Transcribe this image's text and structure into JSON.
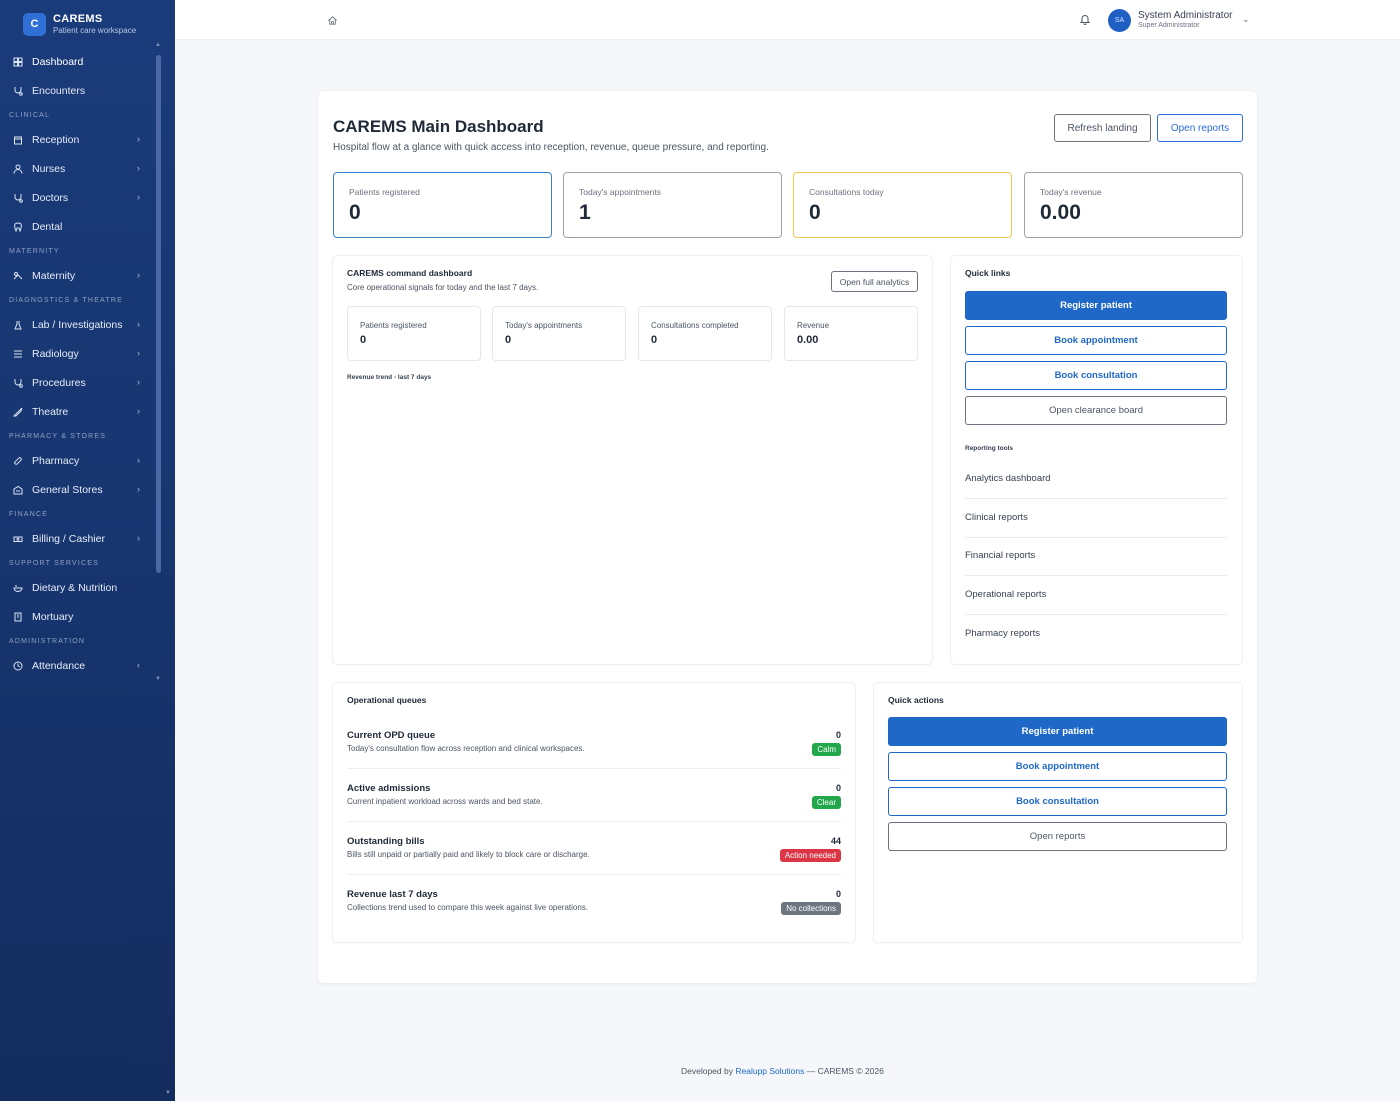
{
  "brand": {
    "logo": "C",
    "title": "CAREMS",
    "subtitle": "Patient care workspace"
  },
  "sidebar": {
    "items": [
      {
        "label": "Dashboard",
        "icon": "grid-icon"
      },
      {
        "label": "Encounters",
        "icon": "stethoscope-icon"
      },
      {
        "section": "Clinical"
      },
      {
        "label": "Reception",
        "icon": "calendar-icon",
        "chevron": "›"
      },
      {
        "label": "Nurses",
        "icon": "user-nurse-icon",
        "chevron": "›"
      },
      {
        "label": "Doctors",
        "icon": "stethoscope-icon",
        "chevron": "›"
      },
      {
        "label": "Dental",
        "icon": "tooth-icon"
      },
      {
        "section": "Maternity"
      },
      {
        "label": "Maternity",
        "icon": "baby-icon",
        "chevron": "›"
      },
      {
        "section": "Diagnostics & Theatre"
      },
      {
        "label": "Lab / Investigations",
        "icon": "flask-icon",
        "chevron": "›"
      },
      {
        "label": "Radiology",
        "icon": "xray-icon",
        "chevron": "›"
      },
      {
        "label": "Procedures",
        "icon": "stethoscope-icon",
        "chevron": "›"
      },
      {
        "label": "Theatre",
        "icon": "scalpel-icon",
        "chevron": "›"
      },
      {
        "section": "Pharmacy & Stores"
      },
      {
        "label": "Pharmacy",
        "icon": "pill-icon",
        "chevron": "›"
      },
      {
        "label": "General Stores",
        "icon": "warehouse-icon",
        "chevron": "›"
      },
      {
        "section": "Finance"
      },
      {
        "label": "Billing / Cashier",
        "icon": "cash-icon",
        "chevron": "›"
      },
      {
        "section": "Support Services"
      },
      {
        "label": "Dietary & Nutrition",
        "icon": "bowl-icon"
      },
      {
        "label": "Mortuary",
        "icon": "building-icon"
      },
      {
        "section": "Administration"
      },
      {
        "label": "Attendance",
        "icon": "clock-icon",
        "chevron": "‹"
      }
    ]
  },
  "topbar": {
    "user_initials": "SA",
    "user_name": "System Administrator",
    "user_role": "Super Administrator"
  },
  "page": {
    "title": "CAREMS Main Dashboard",
    "subtitle": "Hospital flow at a glance with quick access into reception, revenue, queue pressure, and reporting.",
    "refresh_label": "Refresh landing",
    "open_reports_label": "Open reports"
  },
  "stats": [
    {
      "label": "Patients registered",
      "value": "0"
    },
    {
      "label": "Today's appointments",
      "value": "1"
    },
    {
      "label": "Consultations today",
      "value": "0"
    },
    {
      "label": "Today's revenue",
      "value": "0.00"
    }
  ],
  "command": {
    "title": "CAREMS command dashboard",
    "subtitle": "Core operational signals for today and the last 7 days.",
    "analytics_label": "Open full analytics",
    "metrics": [
      {
        "label": "Patients registered",
        "value": "0"
      },
      {
        "label": "Today's appointments",
        "value": "0"
      },
      {
        "label": "Consultations completed",
        "value": "0"
      },
      {
        "label": "Revenue",
        "value": "0.00"
      }
    ],
    "trend_label": "Revenue trend - last 7 days"
  },
  "quick_links": {
    "title": "Quick links",
    "buttons": [
      "Register patient",
      "Book appointment",
      "Book consultation",
      "Open clearance board"
    ],
    "reporting_title": "Reporting tools",
    "reports": [
      "Analytics dashboard",
      "Clinical reports",
      "Financial reports",
      "Operational reports",
      "Pharmacy reports"
    ]
  },
  "queues": {
    "title": "Operational queues",
    "rows": [
      {
        "title": "Current OPD queue",
        "desc": "Today's consultation flow across reception and clinical workspaces.",
        "count": "0",
        "badge": "Calm",
        "badge_color": "#22a74a"
      },
      {
        "title": "Active admissions",
        "desc": "Current inpatient workload across wards and bed state.",
        "count": "0",
        "badge": "Clear",
        "badge_color": "#22a74a"
      },
      {
        "title": "Outstanding bills",
        "desc": "Bills still unpaid or partially paid and likely to block care or discharge.",
        "count": "44",
        "badge": "Action needed",
        "badge_color": "#dc3545"
      },
      {
        "title": "Revenue last 7 days",
        "desc": "Collections trend used to compare this week against live operations.",
        "count": "0",
        "badge": "No collections",
        "badge_color": "#6c7580"
      }
    ]
  },
  "quick_actions": {
    "title": "Quick actions",
    "buttons": [
      "Register patient",
      "Book appointment",
      "Book consultation",
      "Open reports"
    ]
  },
  "footer": {
    "prefix": "Developed by",
    "link": "Realupp Solutions",
    "suffix": "— CAREMS © 2026"
  },
  "colors": {
    "sidebar": "#1a3b7a",
    "primary": "#1f68c8",
    "success": "#22a74a",
    "danger": "#dc3545",
    "muted": "#6c7580"
  }
}
